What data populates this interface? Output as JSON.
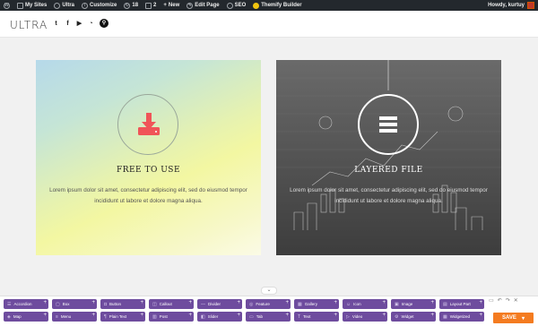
{
  "adminbar": {
    "items": [
      "My Sites",
      "Ultra",
      "Customize",
      "18",
      "2",
      "New",
      "Edit Page",
      "SEO",
      "Themify Builder"
    ],
    "howdy": "Howdy, kurtuy"
  },
  "site": {
    "logo": "ULTRA",
    "social": [
      "twitter-icon",
      "facebook-icon",
      "youtube-icon",
      "rss-icon",
      "search-icon"
    ]
  },
  "cards": [
    {
      "title": "FREE TO USE",
      "text": "Lorem ipsum dolor sit amet, consectetur adipiscing elit, sed do eiusmod tempor incididunt ut labore et dolore magna aliqua.",
      "icon": "download-icon"
    },
    {
      "title": "LAYERED FILE",
      "text": "Lorem ipsum dolor sit amet, consectetur adipiscing elit, sed do eiusmod tempor incididunt ut labore et dolore magna aliqua.",
      "icon": "menu-icon"
    }
  ],
  "builder": {
    "row1": [
      "Accordion",
      "Box",
      "Button",
      "Callout",
      "Divider",
      "Feature",
      "Gallery",
      "Icon",
      "Image",
      "Layout Part"
    ],
    "row2": [
      "Map",
      "Menu",
      "Plain Text",
      "Post",
      "Slider",
      "Tab",
      "Text",
      "Video",
      "Widget",
      "Widgetized"
    ],
    "save": "SAVE"
  },
  "colors": {
    "admin_bg": "#23282d",
    "module": "#6e4c9e",
    "save": "#f47b20",
    "accent": "#f05458"
  }
}
